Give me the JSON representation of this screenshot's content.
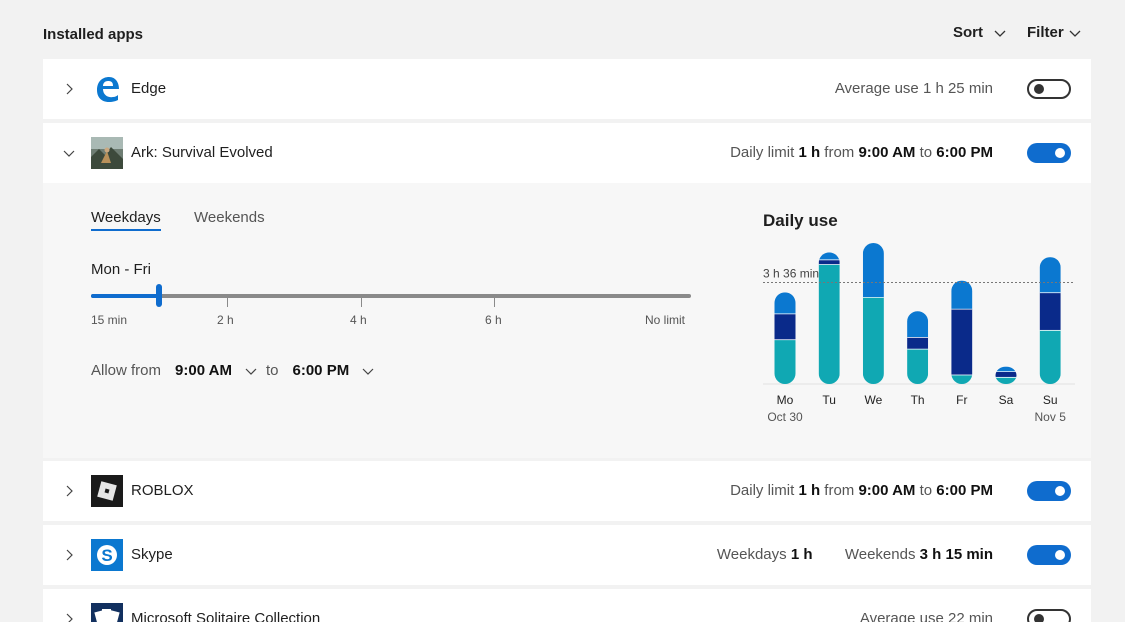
{
  "header": {
    "title": "Installed apps",
    "sort_label": "Sort",
    "filter_label": "Filter"
  },
  "apps": [
    {
      "name": "Edge",
      "info_text": "Average use 1 h 25 min",
      "enabled": false
    },
    {
      "name": "Ark: Survival Evolved",
      "info_prefix": "Daily limit",
      "info_limit": "1 h",
      "info_from": "from",
      "info_start": "9:00 AM",
      "info_to": "to",
      "info_end": "6:00 PM",
      "enabled": true,
      "expanded": true
    },
    {
      "name": "ROBLOX",
      "info_prefix": "Daily limit",
      "info_limit": "1 h",
      "info_from": "from",
      "info_start": "9:00 AM",
      "info_to": "to",
      "info_end": "6:00 PM",
      "enabled": true
    },
    {
      "name": "Skype",
      "weekdays_label": "Weekdays",
      "weekdays_value": "1 h",
      "weekends_label": "Weekends",
      "weekends_value": "3 h 15 min",
      "enabled": true
    },
    {
      "name": "Microsoft Solitaire Collection",
      "info_text": "Average use 22 min",
      "enabled": false
    }
  ],
  "panel": {
    "tabs": [
      "Weekdays",
      "Weekends"
    ],
    "active_tab": "Weekdays",
    "range_label": "Mon - Fri",
    "slider": {
      "ticks": [
        "15 min",
        "2 h",
        "4 h",
        "6 h",
        "No limit"
      ],
      "value": "1 h"
    },
    "allow": {
      "from_label": "Allow from",
      "start": "9:00 AM",
      "to_label": "to",
      "end": "6:00 PM"
    }
  },
  "colors": {
    "accent": "#0f6cce",
    "teal": "#10a8b3",
    "blue": "#0b78d0",
    "navy": "#0a2a8a"
  },
  "chart_data": {
    "type": "bar",
    "title": "Daily use",
    "categories": [
      "Mo",
      "Tu",
      "We",
      "Th",
      "Fr",
      "Sa",
      "Su"
    ],
    "date_labels": [
      "Oct 30",
      "",
      "",
      "",
      "",
      "",
      "Nov 5"
    ],
    "reference_line": {
      "label": "3 h 36 min",
      "value": 216
    },
    "ylim": [
      0,
      300
    ],
    "series": [
      {
        "values": [
          95,
          255,
          185,
          75,
          20,
          15,
          115
        ]
      },
      {
        "values": [
          55,
          10,
          0,
          25,
          140,
          12,
          80
        ]
      },
      {
        "values": [
          45,
          15,
          115,
          55,
          60,
          10,
          75
        ]
      }
    ]
  }
}
